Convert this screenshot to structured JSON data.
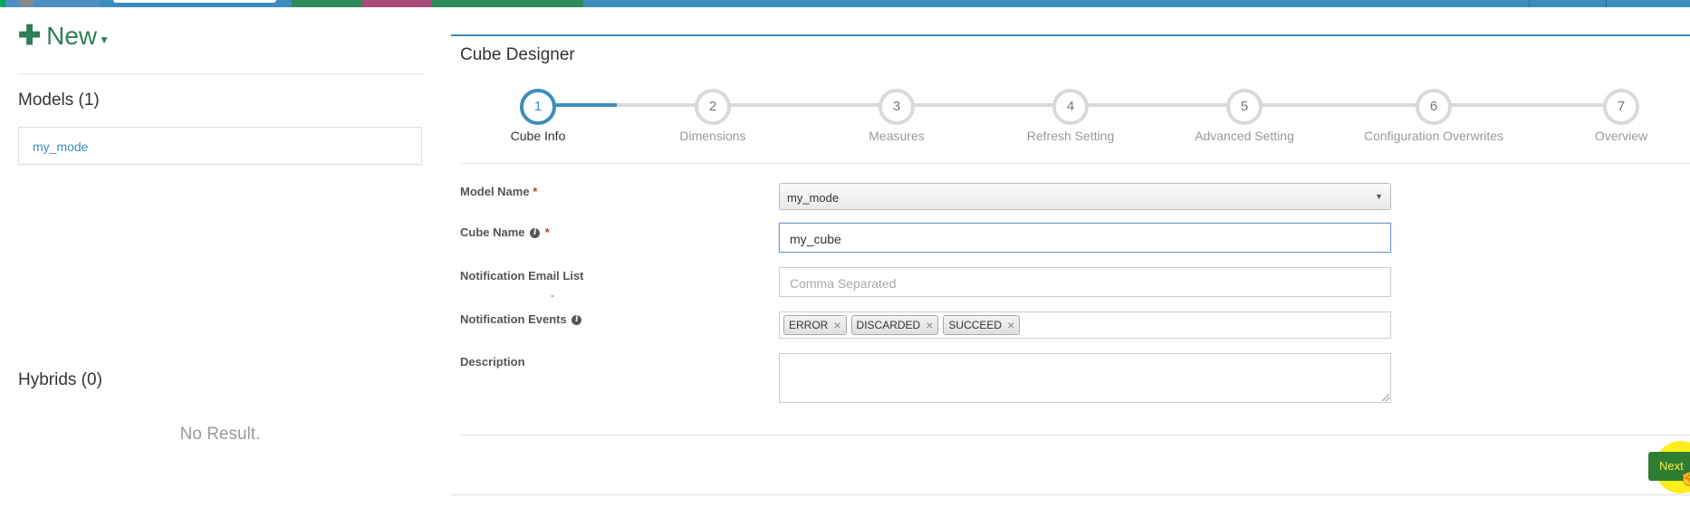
{
  "topbar": {},
  "sidebar": {
    "new_label": "New",
    "models_title": "Models (1)",
    "models": [
      "my_mode"
    ],
    "hybrids_title": "Hybrids (0)",
    "no_result": "No Result."
  },
  "designer": {
    "title": "Cube Designer",
    "active_step": 1,
    "steps": [
      {
        "num": "1",
        "label": "Cube Info"
      },
      {
        "num": "2",
        "label": "Dimensions"
      },
      {
        "num": "3",
        "label": "Measures"
      },
      {
        "num": "4",
        "label": "Refresh Setting"
      },
      {
        "num": "5",
        "label": "Advanced Setting"
      },
      {
        "num": "6",
        "label": "Configuration Overwrites"
      },
      {
        "num": "7",
        "label": "Overview"
      }
    ],
    "form": {
      "model_name_label": "Model Name",
      "model_name_value": "my_mode",
      "cube_name_label": "Cube Name",
      "cube_name_value": "my_cube",
      "email_label": "Notification Email List",
      "email_dash": "-",
      "email_placeholder": "Comma Separated",
      "events_label": "Notification Events",
      "events": [
        "ERROR",
        "DISCARDED",
        "SUCCEED"
      ],
      "description_label": "Description",
      "required_mark": "*",
      "info_glyph": "i"
    },
    "next_label": "Next"
  },
  "colors": {
    "accent": "#3c8dbc",
    "brand_green": "#2e7d5b",
    "next_button": "#2e7d32"
  }
}
